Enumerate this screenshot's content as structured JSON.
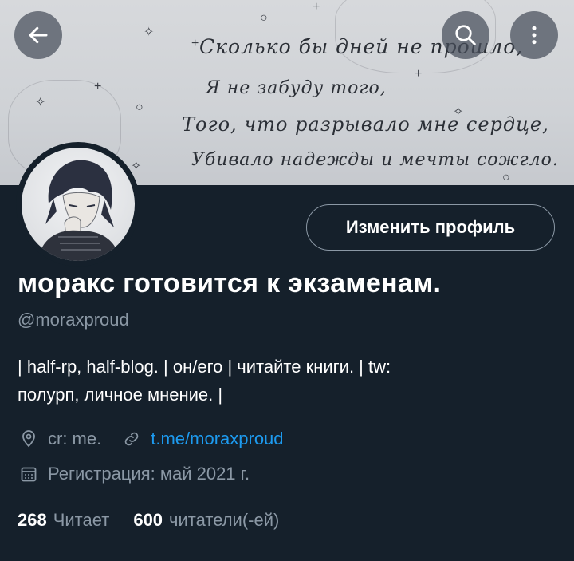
{
  "banner": {
    "lines": [
      "Сколько бы дней не прошло,",
      "Я не забуду того,",
      "Того, что разрывало мне сердце,",
      "Убивало надежды и мечты сожгло."
    ]
  },
  "header": {
    "back_icon": "arrow-left-icon",
    "search_icon": "search-icon",
    "more_icon": "more-vertical-icon"
  },
  "profile": {
    "edit_label": "Изменить профиль",
    "display_name": "моракс готовится к экзаменам.",
    "handle": "@moraxproud",
    "bio_line1": "| half-rp, half-blog. | он/его | читайте книги. | tw:",
    "bio_line2": "полурп, личное мнение. |",
    "location": "cr: me.",
    "website": "t.me/moraxproud",
    "joined": "Регистрация: май 2021 г.",
    "following_count": "268",
    "following_label": "Читает",
    "followers_count": "600",
    "followers_label": "читатели(-ей)"
  },
  "colors": {
    "background": "#15202b",
    "secondary_text": "#8b98a5",
    "link": "#1d9bf0"
  }
}
